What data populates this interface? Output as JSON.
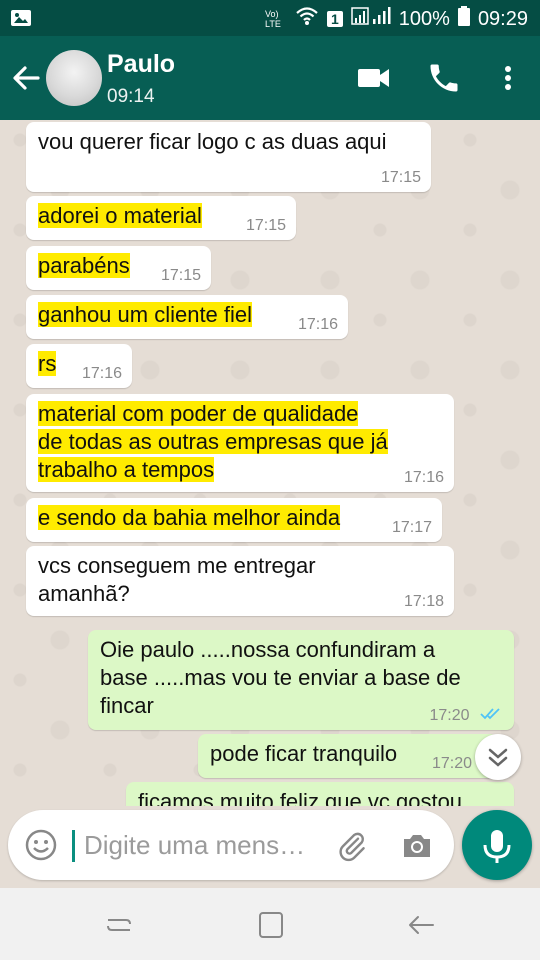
{
  "status_bar": {
    "volte": "Vo) LTE",
    "sim": "1",
    "battery": "100%",
    "time": "09:29"
  },
  "header": {
    "contact_name": "Paulo",
    "subtitle": "09:14"
  },
  "messages": [
    {
      "dir": "in",
      "text": "vou querer ficar logo c as duas aqui",
      "time": "17:15",
      "highlight": false
    },
    {
      "dir": "in",
      "text": "adorei o material",
      "time": "17:15",
      "highlight": true
    },
    {
      "dir": "in",
      "text": "parabéns",
      "time": "17:15",
      "highlight": true
    },
    {
      "dir": "in",
      "text": "ganhou um cliente fiel",
      "time": "17:16",
      "highlight": true
    },
    {
      "dir": "in",
      "text": "rs",
      "time": "17:16",
      "highlight": true
    },
    {
      "dir": "in",
      "text": "material com poder de qualidade\nde todas as outras empresas que já\ntrabalho a tempos",
      "time": "17:16",
      "highlight": true
    },
    {
      "dir": "in",
      "text": "e sendo da bahia melhor ainda",
      "time": "17:17",
      "highlight": true
    },
    {
      "dir": "in",
      "text": "vcs conseguem me entregar\namanhã?",
      "time": "17:18",
      "highlight": false
    },
    {
      "dir": "out",
      "text": "Oie paulo .....nossa confundiram a\nbase .....mas vou te enviar a base de\nfincar",
      "time": "17:20",
      "highlight": false
    },
    {
      "dir": "out",
      "text": "pode ficar tranquilo",
      "time": "17:20",
      "highlight": false
    },
    {
      "dir": "out",
      "text": "ficamos muito feliz que vc gostou",
      "time": "",
      "highlight": false
    }
  ],
  "composer": {
    "placeholder": "Digite uma mens…"
  },
  "colors": {
    "header": "#075e54",
    "status_bar": "#054d44",
    "incoming_bubble": "#ffffff",
    "outgoing_bubble": "#dcf8c6",
    "highlight": "#ffeb00",
    "read_ticks": "#4fc3f7",
    "mic_button": "#00897b"
  }
}
